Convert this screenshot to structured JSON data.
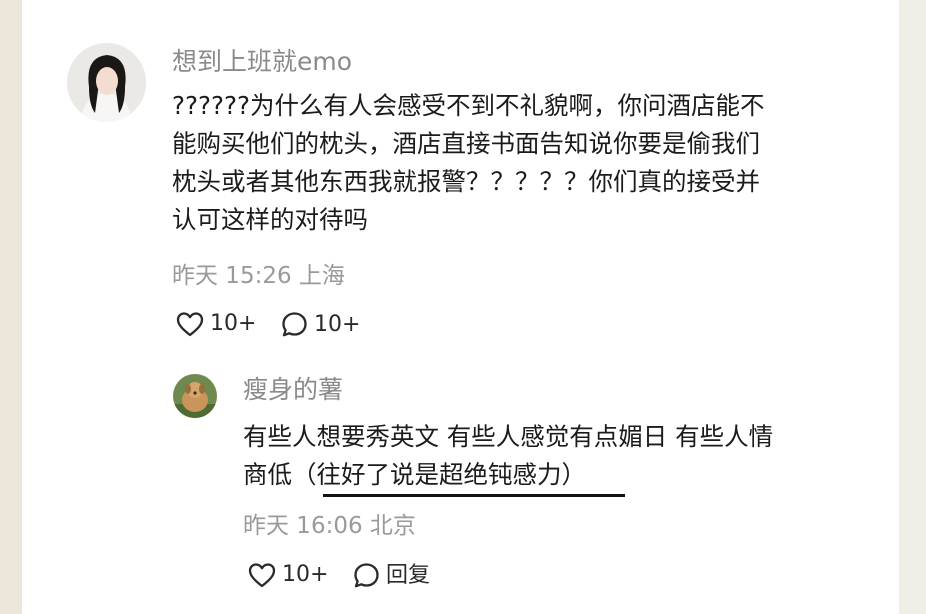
{
  "comment": {
    "username": "想到上班就emo",
    "lines": [
      "??????为什么有人会感受不到不礼貌啊，你问酒店能不",
      "能购买他们的枕头，酒店直接书面告知说你要是偷我们",
      "枕头或者其他东西我就报警？？？？？你们真的接受并",
      "认可这样的对待吗"
    ],
    "time": "昨天 15:26 上海",
    "likes": "10+",
    "replies": "10+"
  },
  "reply": {
    "username": "瘦身的薯",
    "lines": [
      "有些人想要秀英文 有些人感觉有点媚日 有些人情",
      "商低（往好了说是超绝钝感力）"
    ],
    "time": "昨天 16:06 北京",
    "likes": "10+",
    "reply_label": "回复"
  },
  "colors": {
    "text": "#1b1b1b",
    "muted": "#9a9a9a",
    "username": "#8a8a8a",
    "underline": "#111111"
  },
  "icons": [
    "heart-icon",
    "comment-bubble-icon"
  ]
}
